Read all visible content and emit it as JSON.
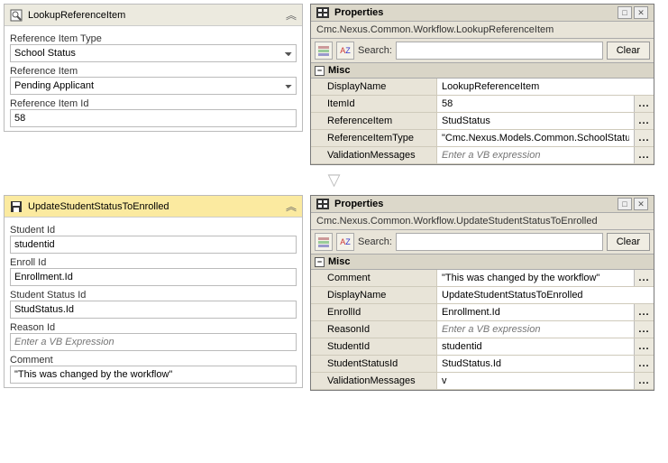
{
  "activity1": {
    "title": "LookupReferenceItem",
    "fields": {
      "refItemType": {
        "label": "Reference Item Type",
        "value": "School Status"
      },
      "refItem": {
        "label": "Reference Item",
        "value": "Pending Applicant"
      },
      "refItemId": {
        "label": "Reference Item Id",
        "value": "58"
      }
    }
  },
  "activity2": {
    "title": "UpdateStudentStatusToEnrolled",
    "fields": {
      "studentId": {
        "label": "Student Id",
        "value": "studentid"
      },
      "enrollId": {
        "label": "Enroll Id",
        "value": "Enrollment.Id"
      },
      "studentStatusId": {
        "label": "Student Status Id",
        "value": "StudStatus.Id"
      },
      "reasonId": {
        "label": "Reason Id",
        "placeholder": "Enter a VB Expression"
      },
      "comment": {
        "label": "Comment",
        "value": "\"This was changed by the workflow\""
      }
    }
  },
  "props1": {
    "title": "Properties",
    "subtitle": "Cmc.Nexus.Common.Workflow.LookupReferenceItem",
    "searchLabel": "Search:",
    "clearLabel": "Clear",
    "miscLabel": "Misc",
    "rows": [
      {
        "name": "DisplayName",
        "value": "LookupReferenceItem",
        "ellipsis": false
      },
      {
        "name": "ItemId",
        "value": "58",
        "ellipsis": true
      },
      {
        "name": "ReferenceItem",
        "value": "StudStatus",
        "ellipsis": true
      },
      {
        "name": "ReferenceItemType",
        "value": "\"Cmc.Nexus.Models.Common.SchoolStatus\"",
        "ellipsis": true
      },
      {
        "name": "ValidationMessages",
        "placeholder": "Enter a VB expression",
        "ellipsis": true
      }
    ]
  },
  "props2": {
    "title": "Properties",
    "subtitle": "Cmc.Nexus.Common.Workflow.UpdateStudentStatusToEnrolled",
    "searchLabel": "Search:",
    "clearLabel": "Clear",
    "miscLabel": "Misc",
    "rows": [
      {
        "name": "Comment",
        "value": "\"This was changed by the workflow\"",
        "ellipsis": true
      },
      {
        "name": "DisplayName",
        "value": "UpdateStudentStatusToEnrolled",
        "ellipsis": false
      },
      {
        "name": "EnrollId",
        "value": "Enrollment.Id",
        "ellipsis": true
      },
      {
        "name": "ReasonId",
        "placeholder": "Enter a VB expression",
        "ellipsis": true
      },
      {
        "name": "StudentId",
        "value": "studentid",
        "ellipsis": true
      },
      {
        "name": "StudentStatusId",
        "value": "StudStatus.Id",
        "ellipsis": true
      },
      {
        "name": "ValidationMessages",
        "value": "v",
        "ellipsis": true
      }
    ]
  },
  "ellipsisLabel": "..."
}
